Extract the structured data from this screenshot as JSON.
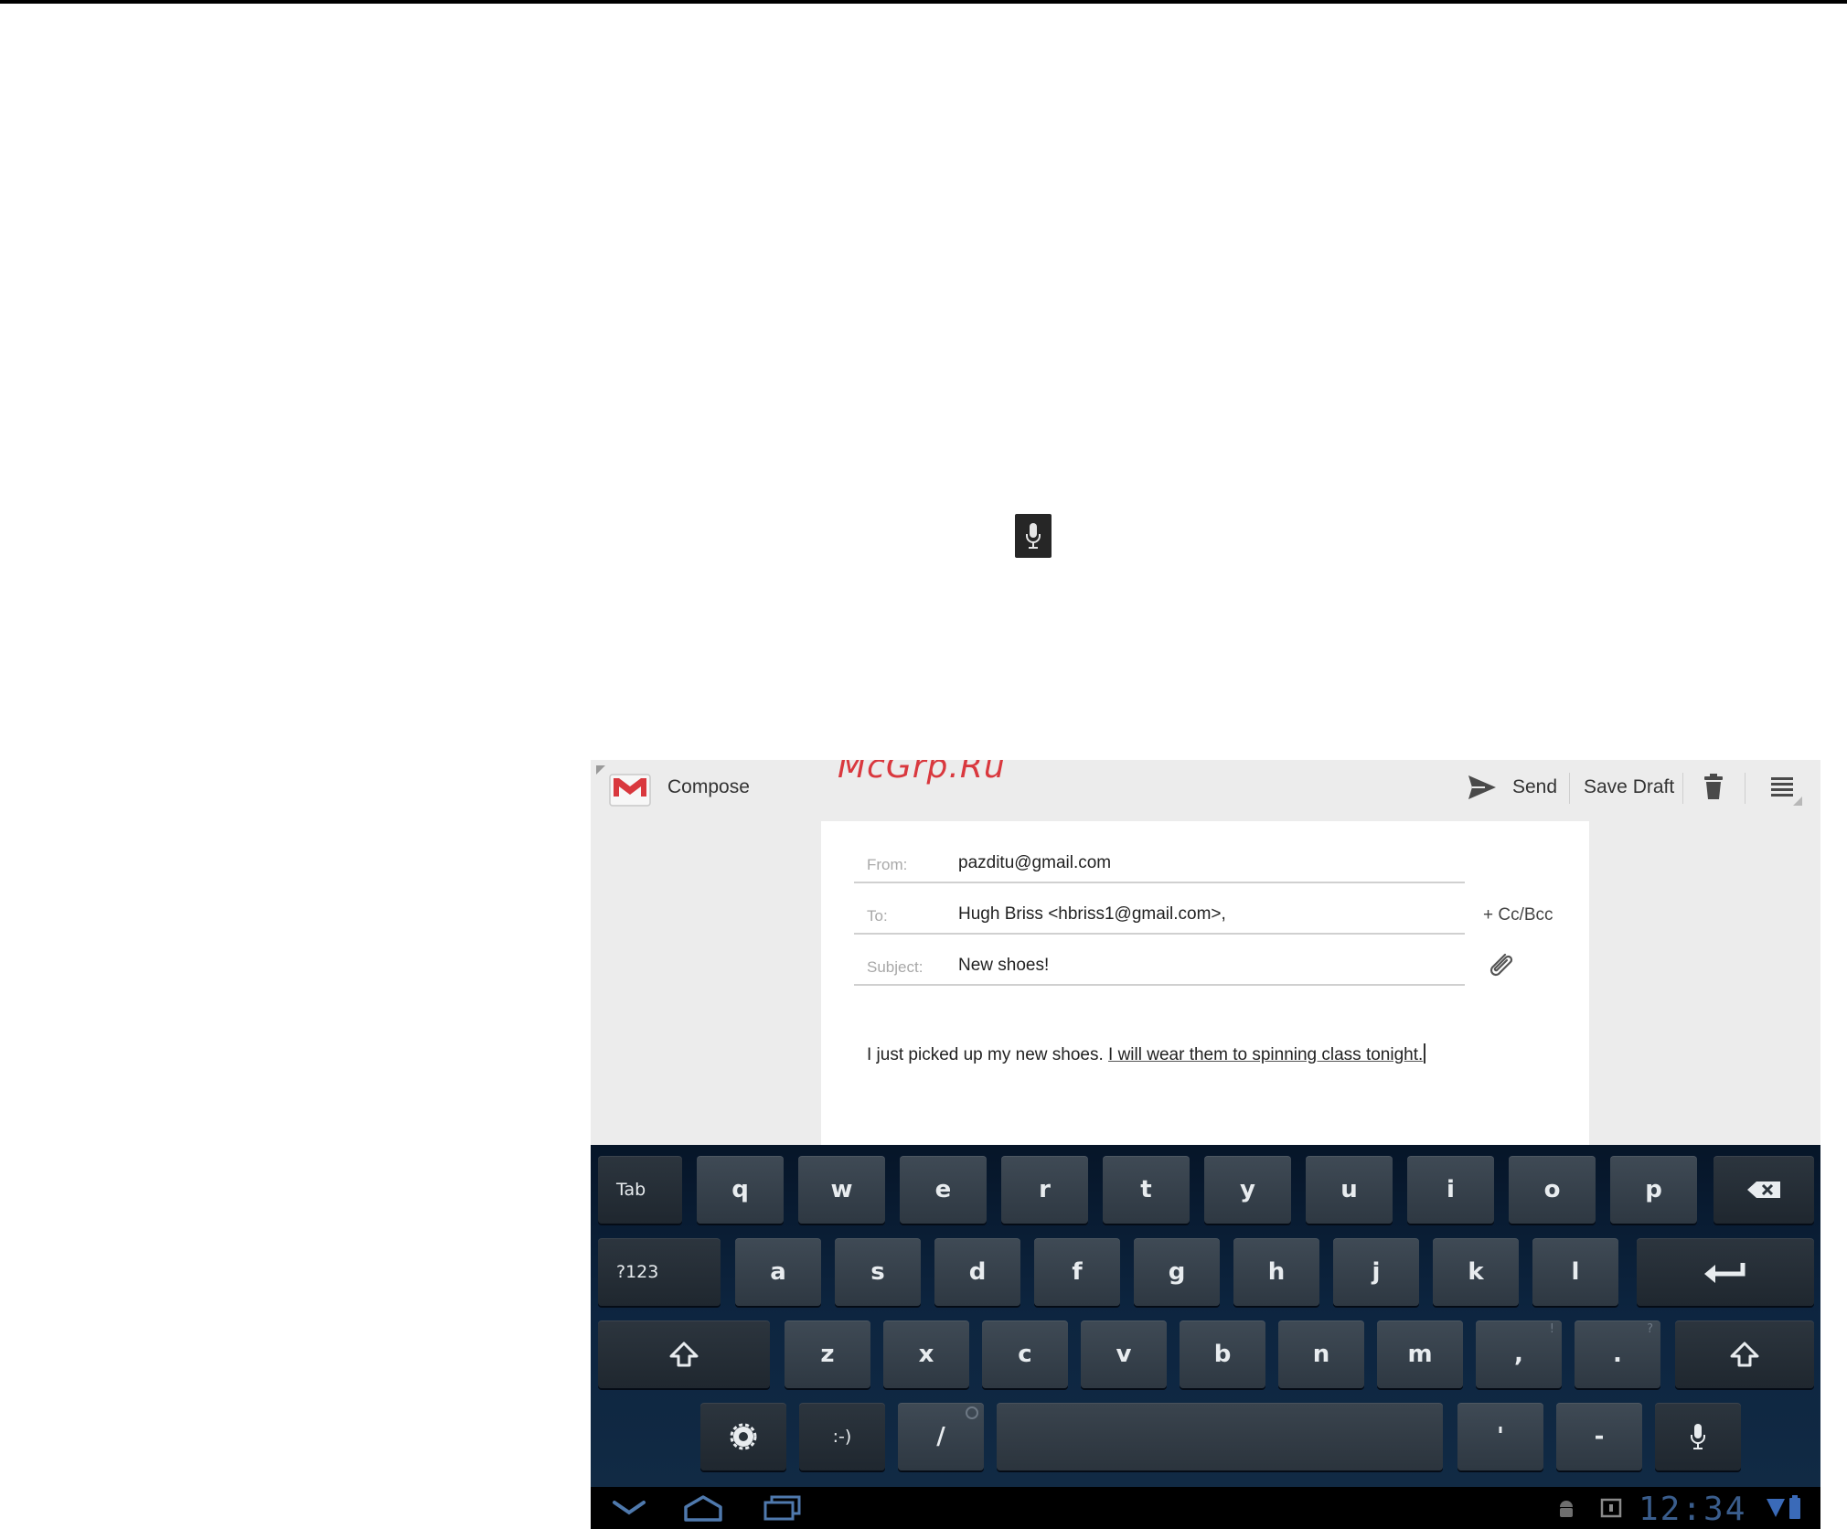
{
  "actionbar": {
    "title": "Compose",
    "send_label": "Send",
    "save_draft_label": "Save Draft"
  },
  "watermark": "McGrp.Ru",
  "compose": {
    "from_label": "From:",
    "from_value": "pazditu@gmail.com",
    "to_label": "To:",
    "to_value": "Hugh Briss <hbriss1@gmail.com>,",
    "cc_bcc_label": "+ Cc/Bcc",
    "subject_label": "Subject:",
    "subject_value": "New shoes!",
    "body_plain": "I just picked up my new shoes. ",
    "body_suggestion": "I will wear them to spinning class tonight."
  },
  "keyboard": {
    "row1": [
      "Tab",
      "q",
      "w",
      "e",
      "r",
      "t",
      "y",
      "u",
      "i",
      "o",
      "p"
    ],
    "row2": [
      "?123",
      "a",
      "s",
      "d",
      "f",
      "g",
      "h",
      "j",
      "k",
      "l"
    ],
    "row3": [
      "z",
      "x",
      "c",
      "v",
      "b",
      "n",
      "m",
      ",",
      "."
    ],
    "row3_hints": [
      "!",
      "?"
    ],
    "row4": [
      ":-)",
      "/",
      "'",
      "-"
    ]
  },
  "statusbar": {
    "time": "12:34"
  },
  "colors": {
    "gmail_red": "#d9383e",
    "clock_blue": "#3a5d8c",
    "keyboard_bg": "#0d2540"
  }
}
